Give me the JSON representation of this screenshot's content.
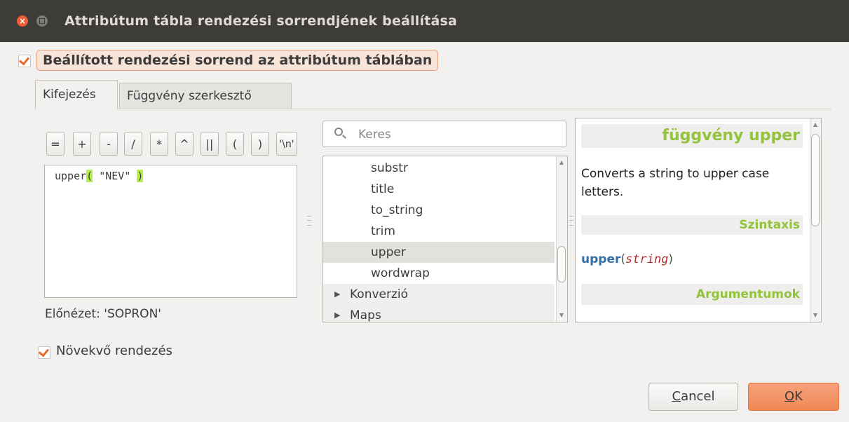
{
  "window": {
    "title": "Attribútum tábla rendezési sorrendjének beállítása",
    "close_glyph": "×"
  },
  "main_checkbox": {
    "label": "Beállított rendezési sorrend az attribútum táblában",
    "checked": true
  },
  "tabs": [
    {
      "label": "Kifejezés",
      "active": true
    },
    {
      "label": "Függvény szerkesztő",
      "active": false
    }
  ],
  "operators": [
    "=",
    "+",
    "-",
    "/",
    "*",
    "^",
    "||",
    "(",
    ")",
    "'\\n'"
  ],
  "editor": {
    "fn": "upper",
    "open_paren": "(",
    "arg": " \"NEV\" ",
    "close_paren": ")"
  },
  "preview": "Előnézet: 'SOPRON'",
  "search": {
    "placeholder": "Keres",
    "value": ""
  },
  "function_list": [
    {
      "label": "substr",
      "kind": "item"
    },
    {
      "label": "title",
      "kind": "item"
    },
    {
      "label": "to_string",
      "kind": "item"
    },
    {
      "label": "trim",
      "kind": "item"
    },
    {
      "label": "upper",
      "kind": "item",
      "selected": true
    },
    {
      "label": "wordwrap",
      "kind": "item"
    },
    {
      "label": "Konverzió",
      "kind": "group"
    },
    {
      "label": "Maps",
      "kind": "group"
    }
  ],
  "help": {
    "heading": "függvény upper",
    "description": "Converts a string to upper case letters.",
    "syntax_heading": "Szintaxis",
    "syntax_fn": "upper",
    "syntax_open": "(",
    "syntax_arg": "string",
    "syntax_close": ")",
    "arguments_heading": "Argumentumok"
  },
  "ascending": {
    "label": "Növekvő rendezés",
    "checked": true
  },
  "buttons": {
    "cancel_mnemonic": "C",
    "cancel_rest": "ancel",
    "ok_mnemonic": "O",
    "ok_rest": "K"
  },
  "colors": {
    "accent": "#e96a2c",
    "highlight": "#b5f04a",
    "help_heading": "#93c23c"
  }
}
